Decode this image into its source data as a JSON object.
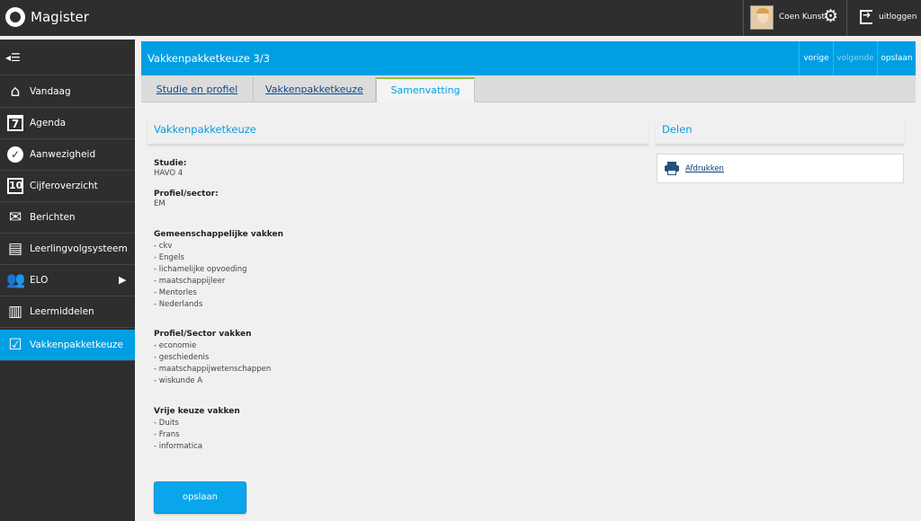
{
  "app": {
    "title": "Magister"
  },
  "user": {
    "name": "Coen Kunst",
    "logout_label": "uitloggen"
  },
  "sidebar": {
    "items": [
      {
        "label": "Vandaag",
        "icon": "home-icon",
        "active": false
      },
      {
        "label": "Agenda",
        "icon": "calendar-icon",
        "active": false
      },
      {
        "label": "Aanwezigheid",
        "icon": "check-circle-icon",
        "active": false
      },
      {
        "label": "Cijferoverzicht",
        "icon": "grade-10-icon",
        "active": false
      },
      {
        "label": "Berichten",
        "icon": "envelope-icon",
        "active": false
      },
      {
        "label": "Leerlingvolgsysteem",
        "icon": "folder-icon",
        "active": false
      },
      {
        "label": "ELO",
        "icon": "users-icon",
        "active": false,
        "has_submenu": true
      },
      {
        "label": "Leermiddelen",
        "icon": "books-icon",
        "active": false
      },
      {
        "label": "Vakkenpakketkeuze",
        "icon": "checklist-icon",
        "active": true
      }
    ]
  },
  "header": {
    "title": "Vakkenpakketkeuze 3/3",
    "prev_label": "vorige",
    "next_label": "volgende",
    "save_label": "opslaan"
  },
  "tabs": [
    {
      "label": "Studie en profiel",
      "active": false
    },
    {
      "label": "Vakkenpakketkeuze",
      "active": false
    },
    {
      "label": "Samenvatting",
      "active": true
    }
  ],
  "summary": {
    "heading": "Vakkenpakketkeuze",
    "studie_label": "Studie:",
    "studie_value": "HAVO 4",
    "profiel_label": "Profiel/sector:",
    "profiel_value": "EM",
    "gemeenschappelijk_label": "Gemeenschappelijke vakken",
    "gemeenschappelijk_items": [
      "- ckv",
      "- Engels",
      "- lichamelijke opvoeding",
      "- maatschappijleer",
      "- Mentorles",
      "- Nederlands"
    ],
    "profielvakken_label": "Profiel/Sector vakken",
    "profielvakken_items": [
      "- economie",
      "- geschiedenis",
      "- maatschappijwetenschappen",
      "- wiskunde A"
    ],
    "vrije_label": "Vrije keuze vakken",
    "vrije_items": [
      "- Duits",
      "- Frans",
      "- informatica"
    ],
    "save_button": "opslaan"
  },
  "share": {
    "heading": "Delen",
    "print_label": "Afdrukken"
  },
  "colors": {
    "accent": "#009fe3",
    "topbar": "#2e2e2e",
    "active_tab_border": "#8cc63f"
  }
}
